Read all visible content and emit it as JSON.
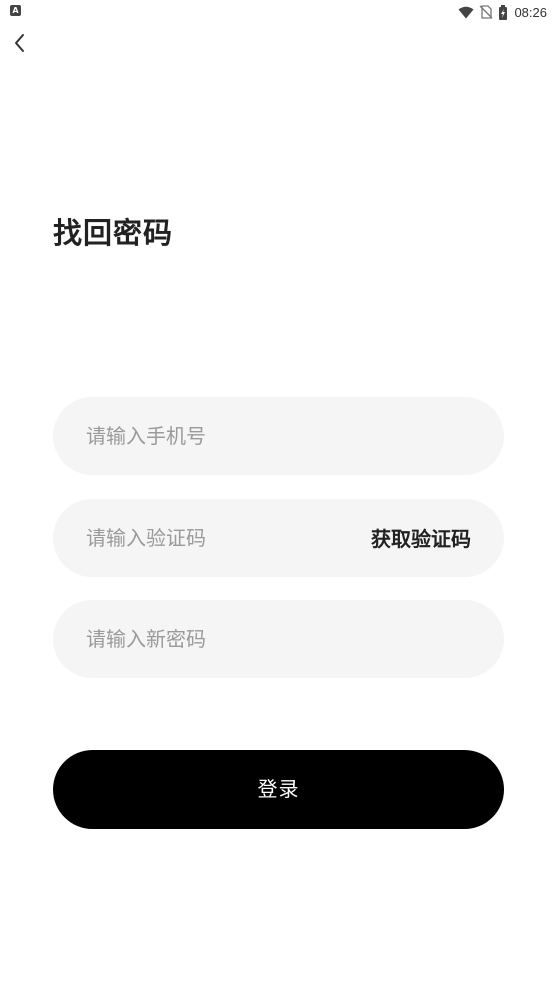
{
  "status_bar": {
    "left_icon": "A",
    "time": "08:26",
    "icons": [
      "wifi-icon",
      "no-sim-icon",
      "battery-charging-icon"
    ]
  },
  "header": {
    "back_icon": "chevron-left-icon"
  },
  "page": {
    "title": "找回密码"
  },
  "form": {
    "phone": {
      "value": "",
      "placeholder": "请输入手机号"
    },
    "code": {
      "value": "",
      "placeholder": "请输入验证码",
      "get_code_label": "获取验证码"
    },
    "password": {
      "value": "",
      "placeholder": "请输入新密码"
    },
    "submit_label": "登录"
  },
  "colors": {
    "background": "#ffffff",
    "field_background": "#f5f5f5",
    "placeholder": "#9a9a9a",
    "button_background": "#000000",
    "button_text": "#ffffff",
    "text": "#222222"
  }
}
